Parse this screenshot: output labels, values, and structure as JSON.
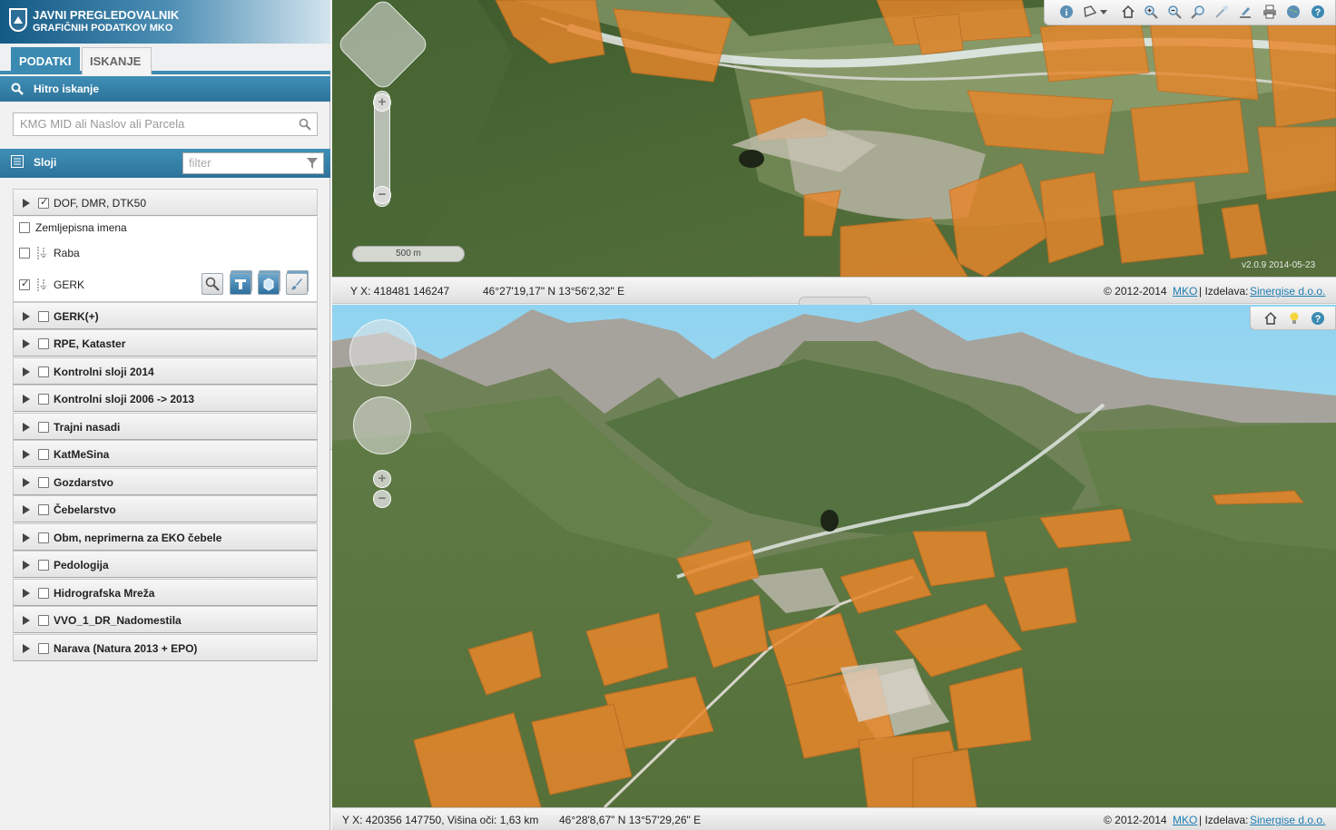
{
  "app": {
    "title_line1": "JAVNI PREGLEDOVALNIK",
    "title_line2": "GRAFIČNIH PODATKOV MKO"
  },
  "tabs": [
    {
      "label": "PODATKI",
      "active": true
    },
    {
      "label": "ISKANJE",
      "active": false
    }
  ],
  "quick_search": {
    "title": "Hitro iskanje",
    "placeholder": "KMG MID ali Naslov ali Parcela"
  },
  "layers": {
    "title": "Sloji",
    "filter_placeholder": "filter",
    "dof_group": {
      "label": "DOF, DMR, DTK50",
      "checked": true
    },
    "sublayers": [
      {
        "label": "Zemljepisna imena",
        "checked": false
      },
      {
        "label": "Raba",
        "checked": false
      },
      {
        "label": "GERK",
        "checked": true
      }
    ],
    "groups": [
      {
        "label": "GERK(+)"
      },
      {
        "label": "RPE, Kataster"
      },
      {
        "label": "Kontrolni sloji 2014"
      },
      {
        "label": "Kontrolni sloji 2006 -> 2013"
      },
      {
        "label": "Trajni nasadi"
      },
      {
        "label": "KatMeSina"
      },
      {
        "label": "Gozdarstvo"
      },
      {
        "label": "Čebelarstvo"
      },
      {
        "label": "Obm, neprimerna za EKO čebele"
      },
      {
        "label": "Pedologija"
      },
      {
        "label": "Hidrografska Mreža"
      },
      {
        "label": "VVO_1_DR_Nadomestila"
      },
      {
        "label": "Narava (Natura 2013 + EPO)"
      }
    ]
  },
  "map2d": {
    "scale_label": "500 m",
    "version": "v2.0.9 2014-05-23",
    "coords_yx": "Y X: 418481 146247",
    "coords_geo": "46°27'19,17\" N 13°56'2,32\" E",
    "copyright": "© 2012-2014",
    "copyright_link": "MKO",
    "made_by": "| Izdelava:",
    "made_by_link": "Sinergise d.o.o."
  },
  "map3d": {
    "coords_yx": "Y X: 420356 147750, Višina oči: 1,63 km",
    "coords_geo": "46°28'8,67\" N 13°57'29,26\" E",
    "copyright": "© 2012-2014",
    "copyright_link": "MKO",
    "made_by": "| Izdelava:",
    "made_by_link": "Sinergise d.o.o."
  },
  "colors": {
    "accent": "#3b8ab2",
    "gerk_fill": "#e8862a",
    "forest": "#3d5a2c",
    "sky": "#8fd3f0"
  }
}
